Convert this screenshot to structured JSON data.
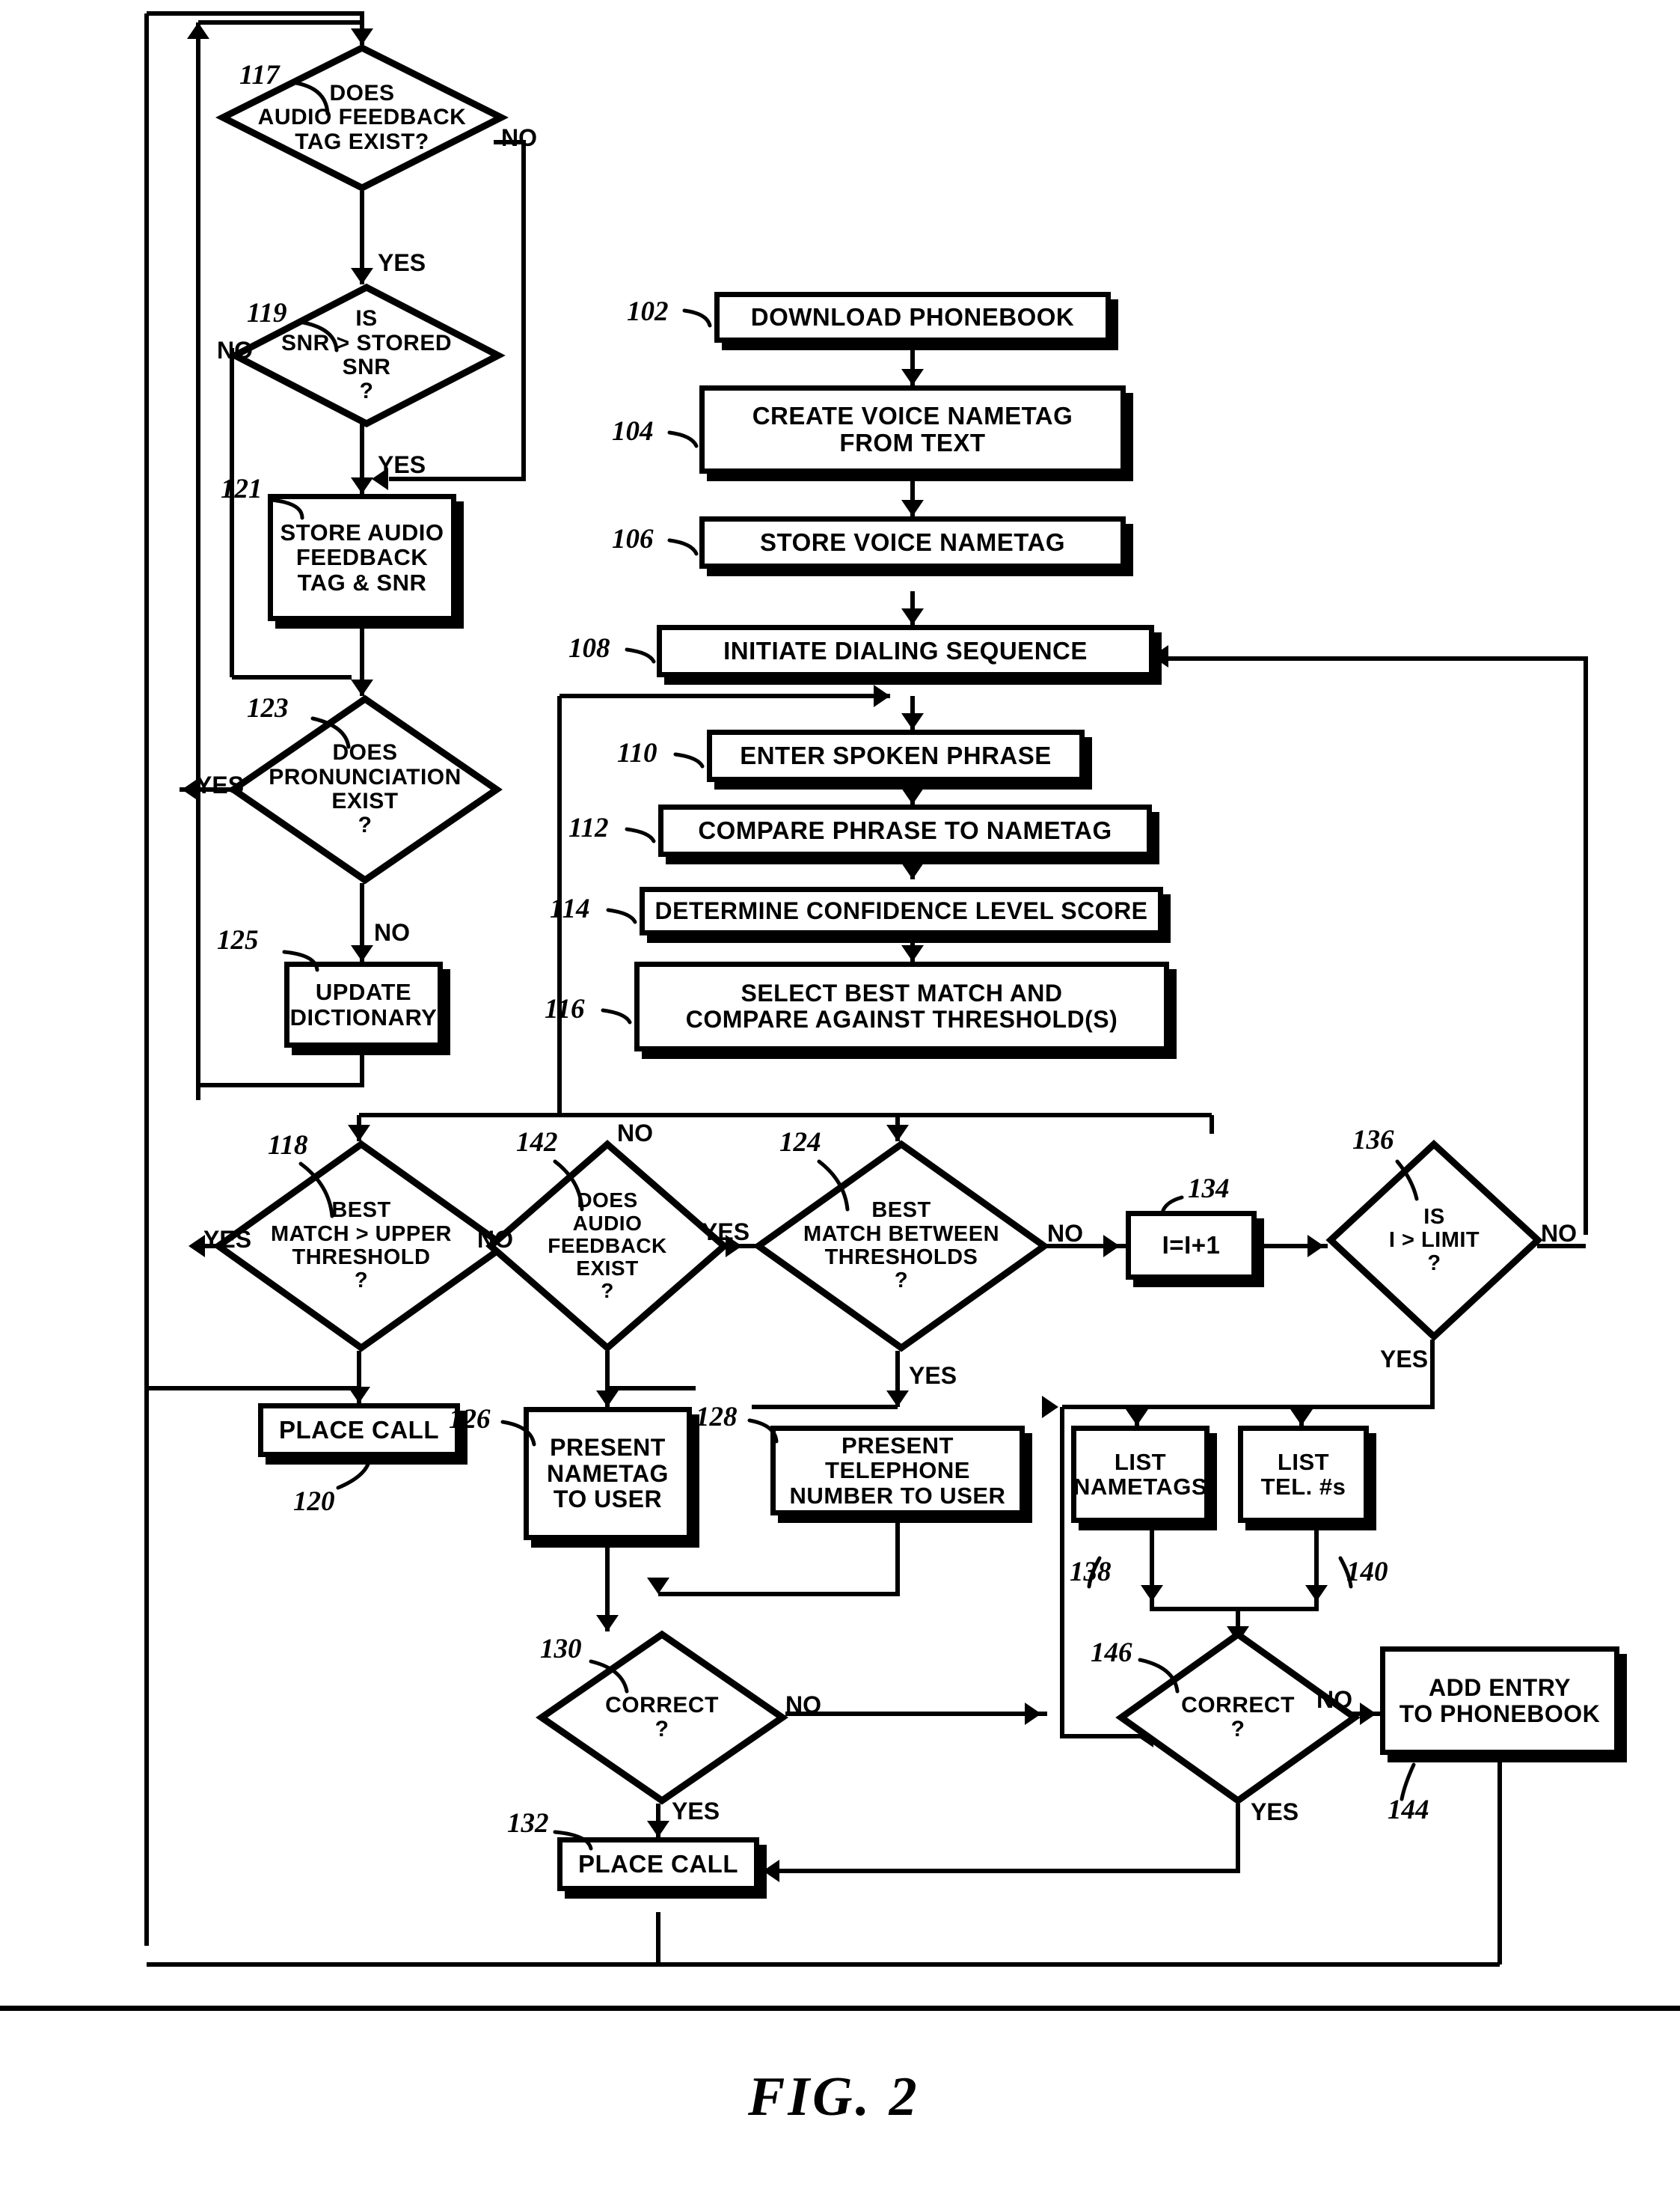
{
  "figure": {
    "caption": "FIG. 2",
    "title": "Voice nametag dialing sequence flowchart"
  },
  "nodes": [
    {
      "ref": "117",
      "kind": "decision",
      "text": "DOES\nAUDIO FEEDBACK\nTAG EXIST?"
    },
    {
      "ref": "119",
      "kind": "decision",
      "text": "IS\nSNR > STORED\nSNR\n?"
    },
    {
      "ref": "121",
      "kind": "process",
      "text": "STORE AUDIO\nFEEDBACK\nTAG & SNR"
    },
    {
      "ref": "123",
      "kind": "decision",
      "text": "DOES\nPRONUNCIATION\nEXIST\n?"
    },
    {
      "ref": "125",
      "kind": "process",
      "text": "UPDATE\nDICTIONARY"
    },
    {
      "ref": "102",
      "kind": "process",
      "text": "DOWNLOAD PHONEBOOK"
    },
    {
      "ref": "104",
      "kind": "process",
      "text": "CREATE VOICE NAMETAG\nFROM TEXT"
    },
    {
      "ref": "106",
      "kind": "process",
      "text": "STORE VOICE NAMETAG"
    },
    {
      "ref": "108",
      "kind": "process",
      "text": "INITIATE DIALING SEQUENCE"
    },
    {
      "ref": "110",
      "kind": "process",
      "text": "ENTER SPOKEN PHRASE"
    },
    {
      "ref": "112",
      "kind": "process",
      "text": "COMPARE PHRASE TO NAMETAG"
    },
    {
      "ref": "114",
      "kind": "process",
      "text": "DETERMINE CONFIDENCE LEVEL SCORE"
    },
    {
      "ref": "116",
      "kind": "process",
      "text": "SELECT BEST MATCH AND\nCOMPARE AGAINST THRESHOLD(S)"
    },
    {
      "ref": "118",
      "kind": "decision",
      "text": "BEST\nMATCH > UPPER\nTHRESHOLD\n?"
    },
    {
      "ref": "142",
      "kind": "decision",
      "text": "DOES\nAUDIO\nFEEDBACK\nEXIST\n?"
    },
    {
      "ref": "124",
      "kind": "decision",
      "text": "BEST\nMATCH BETWEEN\nTHRESHOLDS\n?"
    },
    {
      "ref": "134",
      "kind": "process",
      "text": "I=I+1"
    },
    {
      "ref": "136",
      "kind": "decision",
      "text": "IS\nI > LIMIT\n?"
    },
    {
      "ref": "120",
      "kind": "process",
      "text": "PLACE CALL"
    },
    {
      "ref": "126",
      "kind": "process",
      "text": "PRESENT\nNAMETAG\nTO USER"
    },
    {
      "ref": "128",
      "kind": "process",
      "text": "PRESENT TELEPHONE\nNUMBER TO USER"
    },
    {
      "ref": "138",
      "kind": "process",
      "text": "LIST\nNAMETAGS"
    },
    {
      "ref": "140",
      "kind": "process",
      "text": "LIST\nTEL. #s"
    },
    {
      "ref": "130",
      "kind": "decision",
      "text": "CORRECT\n?"
    },
    {
      "ref": "146",
      "kind": "decision",
      "text": "CORRECT\n?"
    },
    {
      "ref": "144",
      "kind": "process",
      "text": "ADD ENTRY\nTO PHONEBOOK"
    },
    {
      "ref": "132",
      "kind": "process",
      "text": "PLACE CALL"
    }
  ],
  "shapes": {
    "n117": {
      "text": "DOES\nAUDIO FEEDBACK\nTAG EXIST?",
      "ref": "117"
    },
    "n119": {
      "text": "IS\nSNR > STORED\nSNR\n?",
      "ref": "119"
    },
    "n121": {
      "text": "STORE AUDIO\nFEEDBACK\nTAG & SNR",
      "ref": "121"
    },
    "n123": {
      "text": "DOES\nPRONUNCIATION\nEXIST\n?",
      "ref": "123"
    },
    "n125": {
      "text": "UPDATE\nDICTIONARY",
      "ref": "125"
    },
    "n102": {
      "text": "DOWNLOAD PHONEBOOK",
      "ref": "102"
    },
    "n104": {
      "text": "CREATE VOICE NAMETAG\nFROM TEXT",
      "ref": "104"
    },
    "n106": {
      "text": "STORE VOICE NAMETAG",
      "ref": "106"
    },
    "n108": {
      "text": "INITIATE DIALING SEQUENCE",
      "ref": "108"
    },
    "n110": {
      "text": "ENTER SPOKEN PHRASE",
      "ref": "110"
    },
    "n112": {
      "text": "COMPARE PHRASE TO NAMETAG",
      "ref": "112"
    },
    "n114": {
      "text": "DETERMINE CONFIDENCE LEVEL SCORE",
      "ref": "114"
    },
    "n116": {
      "text": "SELECT BEST MATCH AND\nCOMPARE AGAINST THRESHOLD(S)",
      "ref": "116"
    },
    "n118": {
      "text": "BEST\nMATCH > UPPER\nTHRESHOLD\n?",
      "ref": "118"
    },
    "n142": {
      "text": "DOES\nAUDIO\nFEEDBACK\nEXIST\n?",
      "ref": "142"
    },
    "n124": {
      "text": "BEST\nMATCH BETWEEN\nTHRESHOLDS\n?",
      "ref": "124"
    },
    "n134": {
      "text": "I=I+1",
      "ref": "134"
    },
    "n136": {
      "text": "IS\nI > LIMIT\n?",
      "ref": "136"
    },
    "n120": {
      "text": "PLACE CALL",
      "ref": "120"
    },
    "n126": {
      "text": "PRESENT\nNAMETAG\nTO USER",
      "ref": "126"
    },
    "n128": {
      "text": "PRESENT TELEPHONE\nNUMBER TO USER",
      "ref": "128"
    },
    "n138": {
      "text": "LIST\nNAMETAGS",
      "ref": "138"
    },
    "n140": {
      "text": "LIST\nTEL. #s",
      "ref": "140"
    },
    "n130": {
      "text": "CORRECT\n?",
      "ref": "130"
    },
    "n146": {
      "text": "CORRECT\n?",
      "ref": "146"
    },
    "n144": {
      "text": "ADD ENTRY\nTO PHONEBOOK",
      "ref": "144"
    },
    "n132": {
      "text": "PLACE CALL",
      "ref": "132"
    }
  },
  "branch_labels": {
    "b117_no": "NO",
    "b117_yes": "YES",
    "b119_no": "NO",
    "b119_yes": "YES",
    "b123_yes": "YES",
    "b123_no": "NO",
    "b118_yes": "YES",
    "b118_no": "NO",
    "b142_no": "NO",
    "b142_yes": "YES",
    "b124_no": "NO",
    "b124_yes": "YES",
    "b136_no": "NO",
    "b136_yes": "YES",
    "b130_no": "NO",
    "b130_yes": "YES",
    "b146_no": "NO",
    "b146_yes": "YES"
  },
  "colors": {
    "ink": "#000000",
    "paper": "#ffffff"
  }
}
